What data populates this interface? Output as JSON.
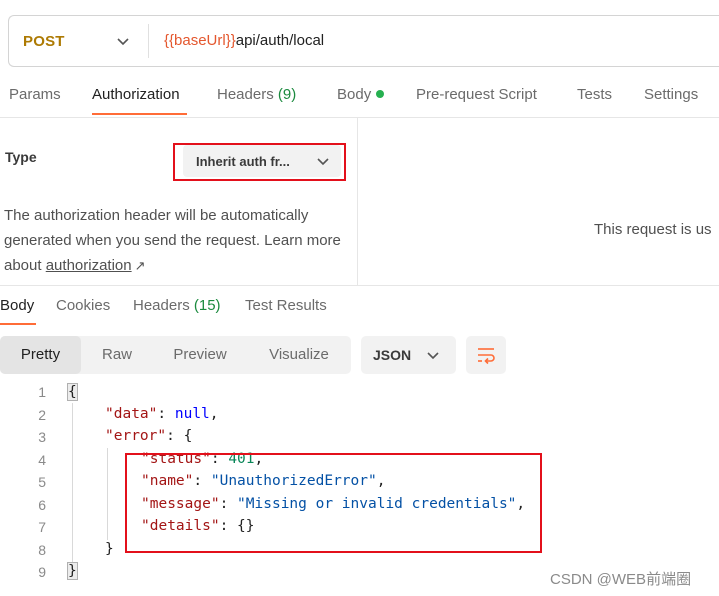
{
  "request": {
    "method": "POST",
    "url_variable": "{{baseUrl}}",
    "url_path": "api/auth/local"
  },
  "request_tabs": [
    {
      "label": "Params"
    },
    {
      "label": "Authorization",
      "active": true
    },
    {
      "label": "Headers",
      "count": "(9)"
    },
    {
      "label": "Body",
      "has_dot": true
    },
    {
      "label": "Pre-request Script"
    },
    {
      "label": "Tests"
    },
    {
      "label": "Settings"
    }
  ],
  "auth": {
    "type_label": "Type",
    "type_value": "Inherit auth fr...",
    "description": "The authorization header will be automatically generated when you send the request. Learn more about ",
    "link_text": "authorization",
    "link_icon": "↗",
    "right_note": "This request is us"
  },
  "response_tabs": [
    {
      "label": "Body",
      "active": true
    },
    {
      "label": "Cookies"
    },
    {
      "label": "Headers",
      "count": "(15)"
    },
    {
      "label": "Test Results"
    }
  ],
  "viewer": {
    "modes": [
      "Pretty",
      "Raw",
      "Preview",
      "Visualize"
    ],
    "active_mode": "Pretty",
    "format": "JSON"
  },
  "code": {
    "line_numbers": [
      "1",
      "2",
      "3",
      "4",
      "5",
      "6",
      "7",
      "8",
      "9"
    ],
    "open_brace": "{",
    "close_brace": "}",
    "data_key": "\"data\"",
    "data_value": "null",
    "error_key": "\"error\"",
    "status_key": "\"status\"",
    "status_value": "401",
    "name_key": "\"name\"",
    "name_value": "\"UnauthorizedError\"",
    "message_key": "\"message\"",
    "message_value": "\"Missing or invalid credentials\"",
    "details_key": "\"details\"",
    "details_value": "{}"
  },
  "watermark": "CSDN @WEB前端圈",
  "colors": {
    "accent": "#ff6c37",
    "method": "#ad7a03",
    "url_variable": "#e4572e",
    "count_green": "#1b8a3e",
    "annotation_red": "#e3101b"
  }
}
